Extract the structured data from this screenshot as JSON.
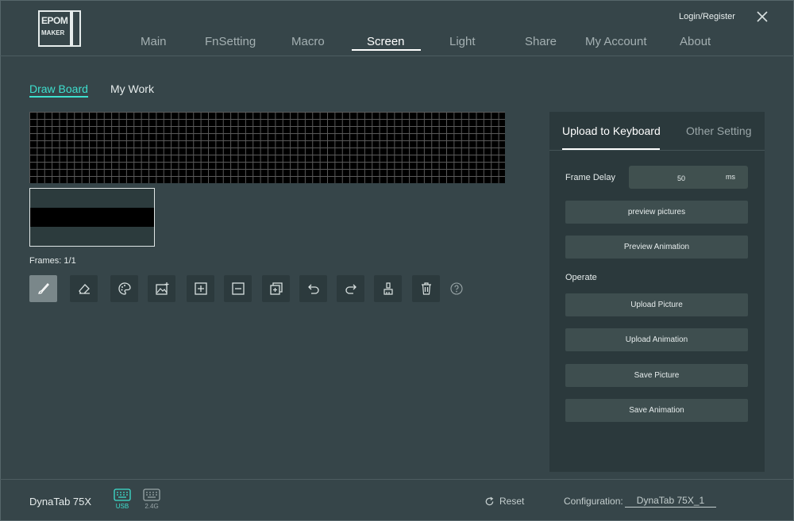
{
  "brand": {
    "logo_text_top": "EPOM",
    "logo_text_bottom": "MAKER"
  },
  "header": {
    "login_label": "Login/Register",
    "nav": [
      {
        "label": "Main"
      },
      {
        "label": "FnSetting"
      },
      {
        "label": "Macro"
      },
      {
        "label": "Screen"
      },
      {
        "label": "Light"
      },
      {
        "label": "Share"
      },
      {
        "label": "My Account"
      },
      {
        "label": "About"
      }
    ],
    "active_nav": "Screen"
  },
  "subtabs": {
    "draw_board": "Draw Board",
    "my_work": "My Work",
    "active": "Draw Board"
  },
  "editor": {
    "frames_label": "Frames: 1/1",
    "tools": [
      {
        "icon": "brush-icon",
        "active": true
      },
      {
        "icon": "eraser-icon",
        "active": false
      },
      {
        "icon": "palette-icon",
        "active": false
      },
      {
        "icon": "image-import-icon",
        "active": false
      },
      {
        "icon": "add-frame-icon",
        "active": false
      },
      {
        "icon": "remove-frame-icon",
        "active": false
      },
      {
        "icon": "copy-frame-icon",
        "active": false
      },
      {
        "icon": "undo-icon",
        "active": false
      },
      {
        "icon": "redo-icon",
        "active": false
      },
      {
        "icon": "clear-broom-icon",
        "active": false
      },
      {
        "icon": "trash-icon",
        "active": false
      }
    ],
    "help_icon": "help-icon"
  },
  "panel": {
    "tab_upload": "Upload to Keyboard",
    "tab_other": "Other Setting",
    "frame_delay_label": "Frame Delay",
    "frame_delay_value": "50",
    "frame_delay_unit": "ms",
    "preview_pictures": "preview pictures",
    "preview_animation": "Preview Animation",
    "operate_label": "Operate",
    "upload_picture": "Upload Picture",
    "upload_animation": "Upload Animation",
    "save_picture": "Save Picture",
    "save_animation": "Save Animation"
  },
  "footer": {
    "device_name": "DynaTab 75X",
    "usb_label": "USB",
    "wireless_label": "2.4G",
    "reset_label": "Reset",
    "config_label": "Configuration:",
    "config_value": "DynaTab 75X_1"
  },
  "colors": {
    "background": "#364549",
    "panel": "#2b393c",
    "accent": "#3ee0cf",
    "button": "#3e4e4f"
  }
}
